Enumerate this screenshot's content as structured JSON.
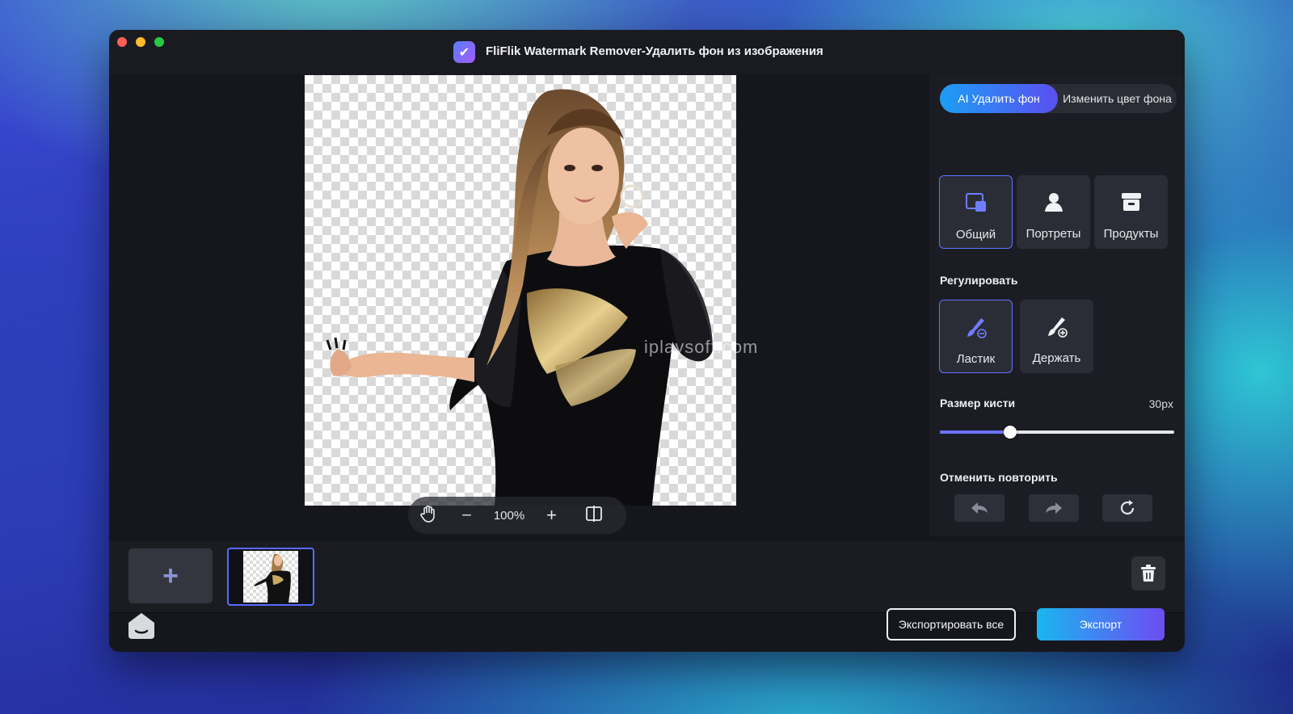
{
  "window": {
    "title": "FliFlik Watermark Remover-Удалить фон из изображения"
  },
  "canvas": {
    "watermark": "iplaysoft.com",
    "zoom": {
      "level": "100%",
      "minus": "−",
      "plus": "+"
    }
  },
  "panel": {
    "tabs": {
      "active": "AI Удалить фон",
      "other": "Изменить цвет фона"
    },
    "modes": [
      {
        "label": "Общий",
        "icon": "general-icon",
        "active": true
      },
      {
        "label": "Портреты",
        "icon": "portrait-icon",
        "active": false
      },
      {
        "label": "Продукты",
        "icon": "product-icon",
        "active": false
      }
    ],
    "adjust_label": "Регулировать",
    "tools": [
      {
        "label": "Ластик",
        "icon": "eraser-brush-icon",
        "active": true
      },
      {
        "label": "Держать",
        "icon": "keep-brush-icon",
        "active": false
      }
    ],
    "brush": {
      "label": "Размер кисти",
      "value_text": "30px",
      "fraction": 0.3
    },
    "history_label": "Отменить повторить"
  },
  "thumbs": {
    "add": "+"
  },
  "footer": {
    "export_all": "Экспортировать все",
    "export": "Экспорт"
  },
  "colors": {
    "accent": "#5e73ff",
    "export_gradient_start": "#19b6f0",
    "export_gradient_end": "#6d4cf2"
  }
}
